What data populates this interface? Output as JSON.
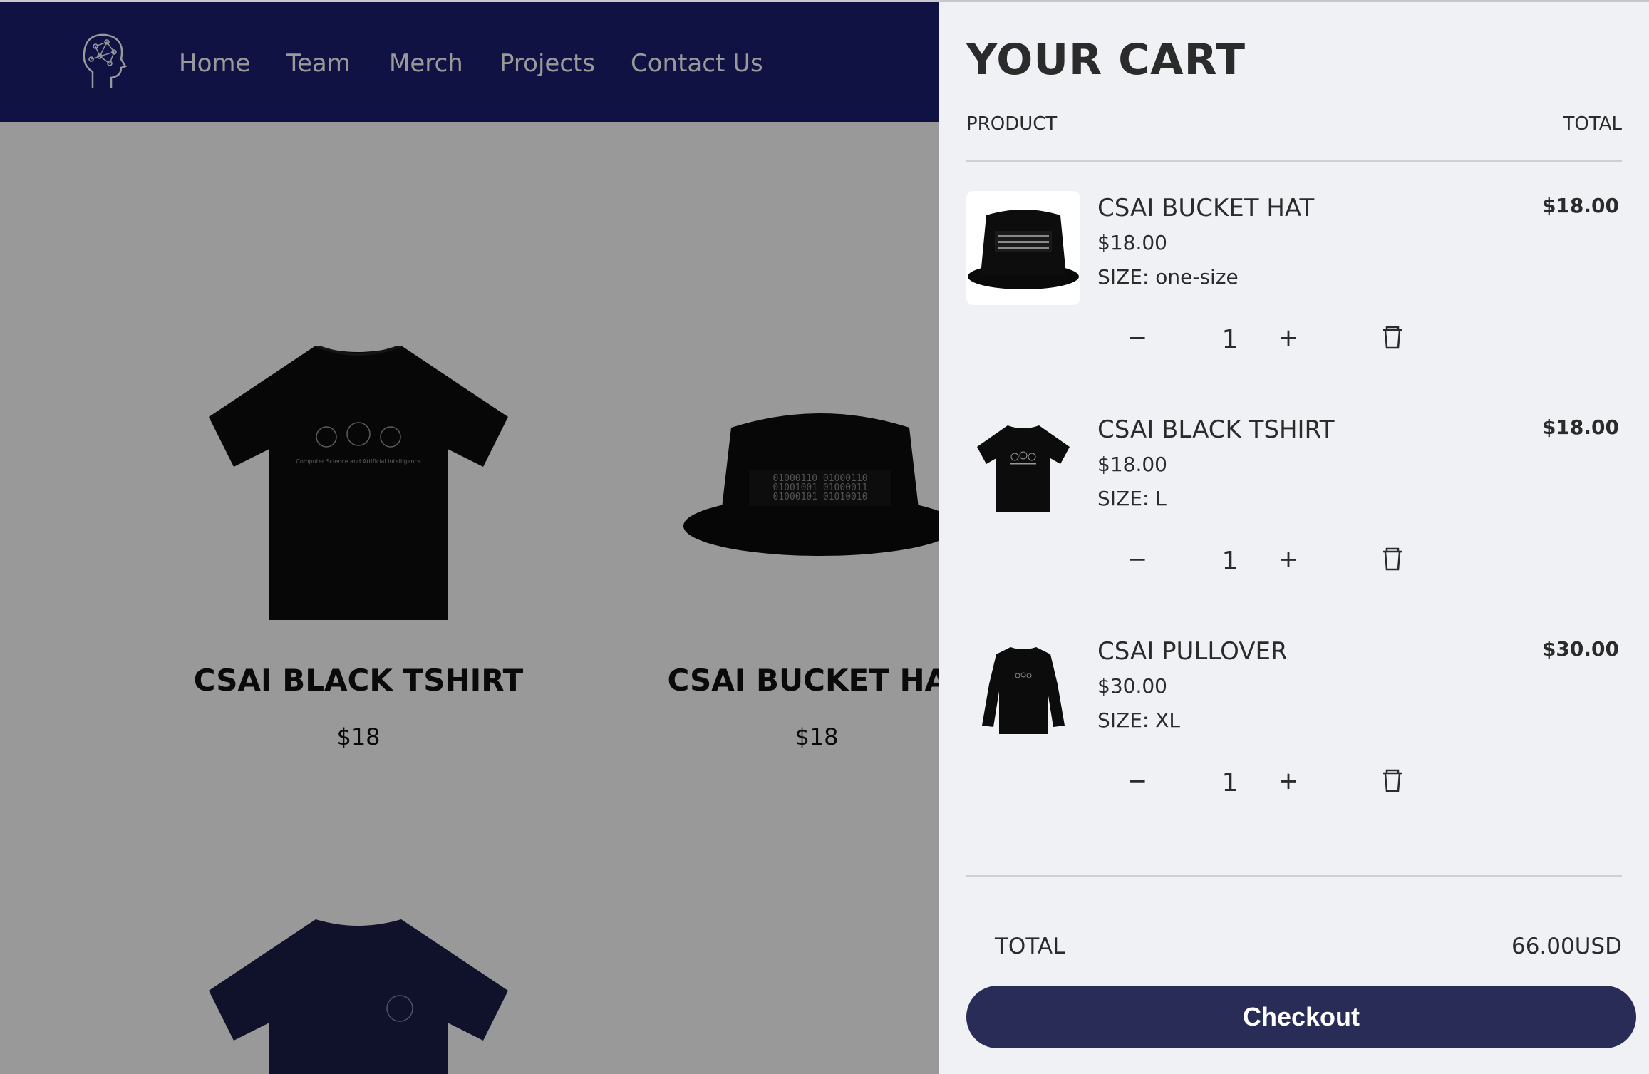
{
  "nav": {
    "links": [
      "Home",
      "Team",
      "Merch",
      "Projects",
      "Contact Us"
    ]
  },
  "products": [
    {
      "name": "CSAI BLACK TSHIRT",
      "price": "$18",
      "image_icon": "black-tshirt-image"
    },
    {
      "name": "CSAI BUCKET HAT",
      "price": "$18",
      "image_icon": "bucket-hat-image"
    },
    {
      "name": "",
      "price": "",
      "image_icon": "navy-tshirt-image"
    }
  ],
  "cart": {
    "title": "YOUR CART",
    "columns": {
      "product": "PRODUCT",
      "total": "TOTAL"
    },
    "items": [
      {
        "name": "CSAI BUCKET HAT",
        "price": "$18.00",
        "size": "SIZE: one-size",
        "quantity": "1",
        "line_total": "$18.00",
        "image_icon": "bucket-hat-thumb"
      },
      {
        "name": "CSAI BLACK TSHIRT",
        "price": "$18.00",
        "size": "SIZE: L",
        "quantity": "1",
        "line_total": "$18.00",
        "image_icon": "black-tshirt-thumb"
      },
      {
        "name": "CSAI PULLOVER",
        "price": "$30.00",
        "size": "SIZE: XL",
        "quantity": "1",
        "line_total": "$30.00",
        "image_icon": "pullover-thumb"
      }
    ],
    "qty_minus": "−",
    "qty_plus": "+",
    "total_label": "TOTAL",
    "total_value": "66.00USD",
    "checkout_label": "Checkout"
  },
  "hat_print_text": [
    "01000110 01000110",
    "01001001 01000011",
    "01000101 01010010"
  ],
  "tshirt_print_text": "Computer Science and Artificial Intelligence",
  "colors": {
    "navbar": "#1a1f6e",
    "cart_bg": "#f0f1f5",
    "checkout_button": "#282c57",
    "overlay": "rgba(0,0,0,0.40)"
  }
}
